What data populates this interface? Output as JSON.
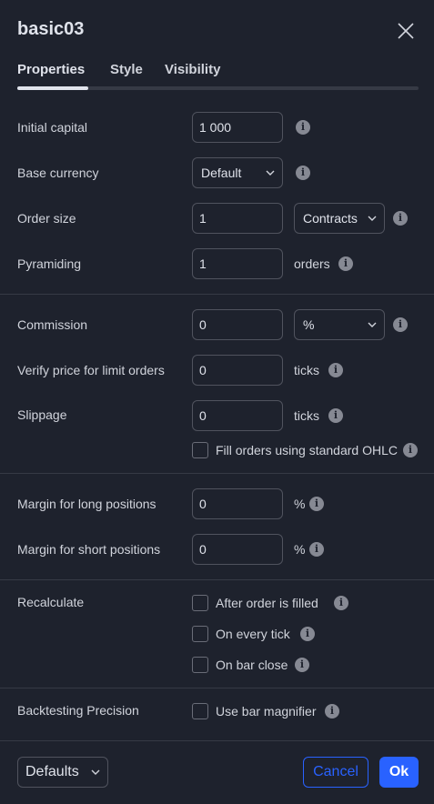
{
  "dialog": {
    "title": "basic03"
  },
  "tabs": [
    {
      "label": "Properties",
      "active": true
    },
    {
      "label": "Style",
      "active": false
    },
    {
      "label": "Visibility",
      "active": false
    }
  ],
  "section1": {
    "initial_capital": {
      "label": "Initial capital",
      "value": "1 000"
    },
    "base_currency": {
      "label": "Base currency",
      "value": "Default"
    },
    "order_size": {
      "label": "Order size",
      "value": "1",
      "unit": "Contracts"
    },
    "pyramiding": {
      "label": "Pyramiding",
      "value": "1",
      "unit": "orders"
    }
  },
  "section2": {
    "commission": {
      "label": "Commission",
      "value": "0",
      "unit": "%"
    },
    "verify_price": {
      "label": "Verify price for limit orders",
      "value": "0",
      "unit": "ticks"
    },
    "slippage": {
      "label": "Slippage",
      "value": "0",
      "unit": "ticks"
    },
    "fill_orders": {
      "label": "Fill orders using standard OHLC",
      "checked": false
    }
  },
  "section3": {
    "margin_long": {
      "label": "Margin for long positions",
      "value": "0",
      "unit": "%"
    },
    "margin_short": {
      "label": "Margin for short positions",
      "value": "0",
      "unit": "%"
    }
  },
  "section4": {
    "label": "Recalculate",
    "options": [
      {
        "label": "After order is filled",
        "checked": false
      },
      {
        "label": "On every tick",
        "checked": false
      },
      {
        "label": "On bar close",
        "checked": false
      }
    ]
  },
  "section5": {
    "label": "Backtesting Precision",
    "option": {
      "label": "Use bar magnifier",
      "checked": false
    }
  },
  "footer": {
    "defaults_label": "Defaults",
    "cancel_label": "Cancel",
    "ok_label": "Ok"
  },
  "icons": {
    "info": "info-icon",
    "close": "close-icon",
    "chevron": "chevron-down-icon"
  },
  "colors": {
    "background": "#1e222d",
    "accent": "#2962ff",
    "text": "#d1d4dc",
    "border": "#50535e"
  }
}
